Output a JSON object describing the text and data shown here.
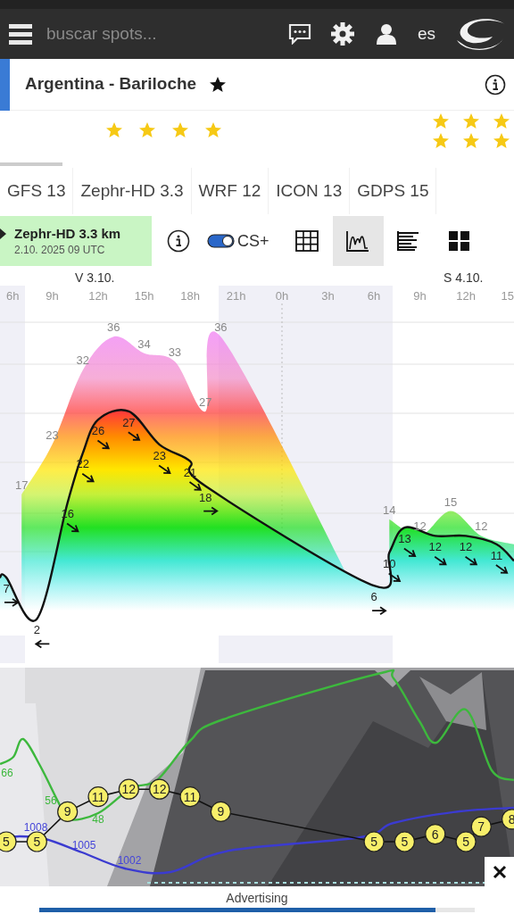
{
  "header": {
    "search": {
      "placeholder": "buscar spots..."
    },
    "language": "es"
  },
  "spot": {
    "title": "Argentina - Bariloche",
    "favorite": true
  },
  "ratings": [
    {
      "stars": 4
    },
    {
      "stars": 3
    },
    {
      "stars": 3
    }
  ],
  "model_tabs": [
    "GFS 13",
    "Zephr-HD 3.3",
    "WRF 12",
    "ICON 13",
    "GDPS 15"
  ],
  "toolbar": {
    "model": "Zephr-HD 3.3 km",
    "run": "2.10. 2025 09 UTC",
    "cs_toggle": {
      "label": "CS+",
      "on": true
    },
    "views": [
      {
        "kind": "grid",
        "selected": false
      },
      {
        "kind": "chart",
        "selected": true
      },
      {
        "kind": "bars",
        "selected": false
      },
      {
        "kind": "tiles",
        "selected": false
      }
    ]
  },
  "days": [
    "V 3.10.",
    "S 4.10."
  ],
  "hours": [
    "6h",
    "9h",
    "12h",
    "15h",
    "18h",
    "21h",
    "0h",
    "3h",
    "6h",
    "9h",
    "12h",
    "15"
  ],
  "wind_chart": {
    "gust_labels": [
      "17",
      "23",
      "32",
      "36",
      "34",
      "33",
      "27",
      "36",
      "14",
      "12",
      "15",
      "12"
    ],
    "wind_points": [
      {
        "label": "7",
        "kind": "east"
      },
      {
        "label": "2",
        "kind": "west"
      },
      {
        "label": "16",
        "kind": "southeast"
      },
      {
        "label": "22",
        "kind": "southeast"
      },
      {
        "label": "26",
        "kind": "southeast"
      },
      {
        "label": "27",
        "kind": "southeast"
      },
      {
        "label": "23",
        "kind": "southeast"
      },
      {
        "label": "21",
        "kind": "southeast"
      },
      {
        "label": "18",
        "kind": "east"
      },
      {
        "label": "6",
        "kind": "east"
      },
      {
        "label": "10",
        "kind": "southeast"
      },
      {
        "label": "13",
        "kind": "southeast"
      },
      {
        "label": "12",
        "kind": "southeast"
      },
      {
        "label": "12",
        "kind": "southeast"
      },
      {
        "label": "11",
        "kind": "southeast"
      }
    ]
  },
  "meteo_chart": {
    "temperatures": [
      "5",
      "5",
      "9",
      "11",
      "12",
      "12",
      "11",
      "9",
      "5",
      "5",
      "6",
      "5",
      "7",
      "8"
    ],
    "humidity_labels": [
      "66",
      "56",
      "48"
    ],
    "pressure_labels": [
      "1008",
      "1005",
      "1002"
    ]
  },
  "advertising": "Advertising"
}
